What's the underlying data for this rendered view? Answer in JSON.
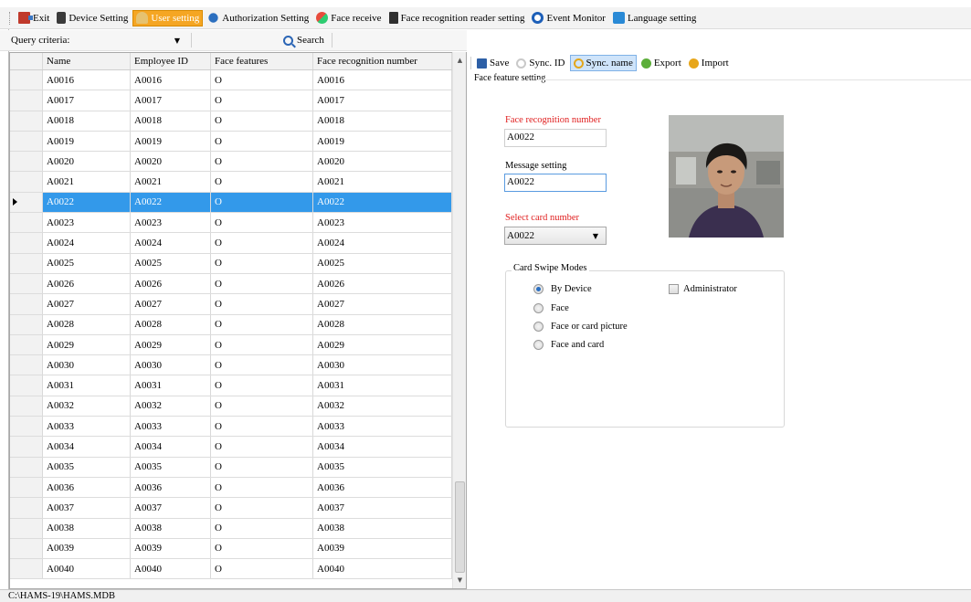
{
  "menubar": {
    "items": [
      {
        "label": "Exit",
        "icon": "exit-icon"
      },
      {
        "label": "Device Setting",
        "icon": "device-icon"
      },
      {
        "label": "User setting",
        "icon": "user-icon"
      },
      {
        "label": "Authorization Setting",
        "icon": "authorization-icon"
      },
      {
        "label": "Face receive",
        "icon": "face-receive-icon"
      },
      {
        "label": "Face recognition reader setting",
        "icon": "reader-icon"
      },
      {
        "label": "Event Monitor",
        "icon": "event-monitor-icon"
      },
      {
        "label": "Language setting",
        "icon": "language-icon"
      }
    ],
    "active_index": 2
  },
  "query": {
    "criteria_label": "Query criteria:",
    "search_label": "Search"
  },
  "grid": {
    "columns": [
      "Name",
      "Employee ID",
      "Face features",
      "Face recognition number"
    ],
    "rows": [
      [
        "A0016",
        "A0016",
        "O",
        "A0016"
      ],
      [
        "A0017",
        "A0017",
        "O",
        "A0017"
      ],
      [
        "A0018",
        "A0018",
        "O",
        "A0018"
      ],
      [
        "A0019",
        "A0019",
        "O",
        "A0019"
      ],
      [
        "A0020",
        "A0020",
        "O",
        "A0020"
      ],
      [
        "A0021",
        "A0021",
        "O",
        "A0021"
      ],
      [
        "A0022",
        "A0022",
        "O",
        "A0022"
      ],
      [
        "A0023",
        "A0023",
        "O",
        "A0023"
      ],
      [
        "A0024",
        "A0024",
        "O",
        "A0024"
      ],
      [
        "A0025",
        "A0025",
        "O",
        "A0025"
      ],
      [
        "A0026",
        "A0026",
        "O",
        "A0026"
      ],
      [
        "A0027",
        "A0027",
        "O",
        "A0027"
      ],
      [
        "A0028",
        "A0028",
        "O",
        "A0028"
      ],
      [
        "A0029",
        "A0029",
        "O",
        "A0029"
      ],
      [
        "A0030",
        "A0030",
        "O",
        "A0030"
      ],
      [
        "A0031",
        "A0031",
        "O",
        "A0031"
      ],
      [
        "A0032",
        "A0032",
        "O",
        "A0032"
      ],
      [
        "A0033",
        "A0033",
        "O",
        "A0033"
      ],
      [
        "A0034",
        "A0034",
        "O",
        "A0034"
      ],
      [
        "A0035",
        "A0035",
        "O",
        "A0035"
      ],
      [
        "A0036",
        "A0036",
        "O",
        "A0036"
      ],
      [
        "A0037",
        "A0037",
        "O",
        "A0037"
      ],
      [
        "A0038",
        "A0038",
        "O",
        "A0038"
      ],
      [
        "A0039",
        "A0039",
        "O",
        "A0039"
      ],
      [
        "A0040",
        "A0040",
        "O",
        "A0040"
      ]
    ],
    "selected_index": 6
  },
  "toolbar": {
    "save_label": "Save",
    "sync_id_label": "Sync. ID",
    "sync_name_label": "Sync. name",
    "export_label": "Export",
    "import_label": "Import"
  },
  "detail": {
    "section_title": "Face feature setting",
    "face_number_label": "Face recognition number",
    "face_number_value": "A0022",
    "message_label": "Message setting",
    "message_value": "A0022",
    "card_label": "Select card number",
    "card_value": "A0022"
  },
  "card_modes": {
    "title": "Card Swipe Modes",
    "options": [
      "By Device",
      "Face",
      "Face or card picture",
      "Face and card"
    ],
    "selected_index": 0,
    "administrator_label": "Administrator",
    "administrator_checked": false
  },
  "status": {
    "path": "C:\\HAMS-19\\HAMS.MDB"
  },
  "colors": {
    "selection": "#3399ea",
    "active_menu": "#f5a623",
    "required_label": "#e02020"
  }
}
